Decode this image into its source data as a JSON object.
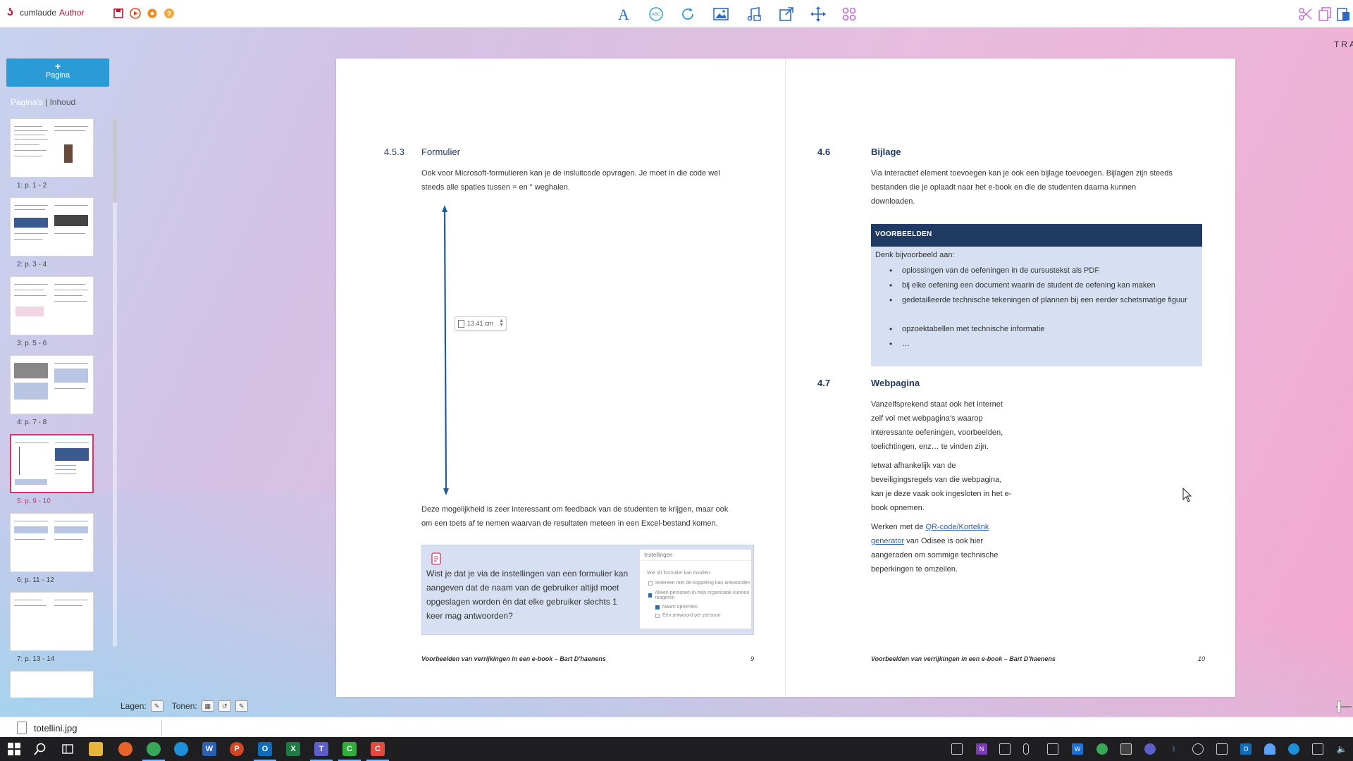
{
  "app": {
    "brand_name": "cumlaude",
    "brand_role": "Author",
    "right_edge_text": "TRA"
  },
  "sidebar": {
    "add_page": {
      "plus": "+",
      "label": "Pagina"
    },
    "tabs": {
      "pages": "Pagina's",
      "sep": "|",
      "content": "Inhoud"
    },
    "thumbnails": [
      {
        "label": "1: p. 1 - 2"
      },
      {
        "label": "2: p. 3 - 4"
      },
      {
        "label": "3: p. 5 - 6"
      },
      {
        "label": "4: p. 7 - 8"
      },
      {
        "label": "5: p. 9 - 10",
        "selected": true
      },
      {
        "label": "6: p. 11 - 12"
      },
      {
        "label": "7: p. 13 - 14"
      }
    ]
  },
  "page_left": {
    "section_num": "4.5.3",
    "section_title": "Formulier",
    "intro_1": "Ook voor Microsoft-formulieren kan je de insluitcode opvragen. Je moet in die code wel",
    "intro_2": "steeds alle spaties tussen = en \" weghalen.",
    "dimension": "13.41 cm",
    "para2_1": "Deze mogelijkheid is zeer interessant om feedback van de studenten te krijgen, maar ook",
    "para2_2": "om een toets af te nemen waarvan de resultaten meteen in een Excel-bestand komen.",
    "tip_lines": [
      "Wist je dat je via de instellingen van een formulier kan",
      "aangeven dat de naam van de gebruiker altijd moet",
      "opgeslagen worden én dat elke gebruiker slechts 1",
      "keer mag antwoorden?"
    ],
    "settings_mini": {
      "title": "Instellingen",
      "q": "Wie dit formulier kan invullen",
      "opt1": "Iedereen met de koppeling kan antwoorden",
      "opt2": "Alleen personen in mijn organisatie kunnen reageren",
      "opt3": "Naam opnemen",
      "opt4": "Eén antwoord per persoon"
    },
    "footer": "Voorbeelden van verrijkingen in een e-book – Bart D'haenens",
    "page_num": "9"
  },
  "page_right": {
    "s1_num": "4.6",
    "s1_title": "Bijlage",
    "s1_lines": [
      "Via Interactief element toevoegen kan je ook een bijlage toevoegen. Bijlagen zijn steeds",
      "bestanden die je oplaadt naar het e-book en die de studenten daarna kunnen",
      "downloaden."
    ],
    "examples_head": "VOORBEELDEN",
    "examples_intro": "Denk bijvoorbeeld aan:",
    "examples": [
      "oplossingen van de oefeningen in de cursustekst als PDF",
      "bij elke oefening een document waarin de student de oefening kan maken",
      "gedetailleerde technische tekeningen of plannen bij een eerder schetsmatige figuur",
      "opzoektabellen met technische informatie",
      "…"
    ],
    "s2_num": "4.7",
    "s2_title": "Webpagina",
    "p1": [
      "Vanzelfsprekend staat ook het internet",
      "zelf vol met webpagina's waarop",
      "interessante oefeningen, voorbeelden,",
      "toelichtingen, enz… te vinden zijn."
    ],
    "p2": [
      "Ietwat afhankelijk van de",
      "beveiligingsregels van die webpagina,",
      "kan je deze vaak ook ingesloten in het e-",
      "book opnemen."
    ],
    "p3_prefix": "Werken met de ",
    "p3_link1": "QR-code/Kortelink",
    "p3_link2": "generator",
    "p3_suffix": " van Odisee is ook hier",
    "p3_rest": [
      "aangeraden om sommige technische",
      "beperkingen te omzeilen."
    ],
    "footer": "Voorbeelden van verrijkingen in een e-book – Bart D'haenens",
    "page_num": "10"
  },
  "bottom_bar": {
    "layers_label": "Lagen:",
    "show_label": "Tonen:"
  },
  "download": {
    "filename": "totellini.jpg"
  },
  "colors": {
    "accent_blue": "#2b9bd6",
    "heading_navy": "#1f3b64",
    "highlight_pink": "#d6336c",
    "box_blue": "#d7dff2"
  }
}
